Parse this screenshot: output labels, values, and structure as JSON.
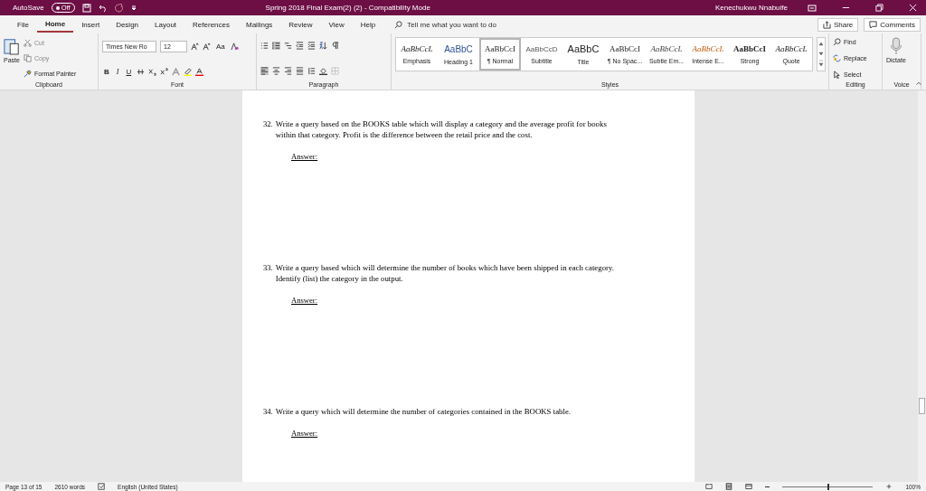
{
  "title_bar": {
    "autosave_label": "AutoSave",
    "autosave_toggle": {
      "label": "Off",
      "on": false
    },
    "title": "Spring 2018 Final Exam(2) (2)  -  Compatibility Mode",
    "user": "Kenechukwu Nnabuife"
  },
  "tabs": [
    {
      "label": "File",
      "selected": false
    },
    {
      "label": "Home",
      "selected": true
    },
    {
      "label": "Insert",
      "selected": false
    },
    {
      "label": "Design",
      "selected": false
    },
    {
      "label": "Layout",
      "selected": false
    },
    {
      "label": "References",
      "selected": false
    },
    {
      "label": "Mailings",
      "selected": false
    },
    {
      "label": "Review",
      "selected": false
    },
    {
      "label": "View",
      "selected": false
    },
    {
      "label": "Help",
      "selected": false
    }
  ],
  "tell_me": {
    "placeholder": "Tell me what you want to do"
  },
  "share": "Share",
  "comments": "Comments",
  "clipboard": {
    "paste": "Paste",
    "cut": "Cut",
    "copy": "Copy",
    "format_painter": "Format Painter",
    "label": "Clipboard"
  },
  "font": {
    "font_name": "Times New Ro",
    "font_size": "12",
    "change_case": "Aa",
    "bold": "B",
    "italic": "I",
    "underline": "U",
    "label": "Font"
  },
  "paragraph": {
    "label": "Paragraph"
  },
  "styles": {
    "label": "Styles",
    "items": [
      {
        "kind": "emphasis",
        "sample": "AaBbCcL",
        "name": "Emphasis",
        "selected": false
      },
      {
        "kind": "heading",
        "sample": "AaBbC",
        "name": "Heading 1",
        "selected": false
      },
      {
        "kind": "normal",
        "sample": "AaBbCcI",
        "name": "¶ Normal",
        "selected": true
      },
      {
        "kind": "subtitle",
        "sample": "AaBbCcD",
        "name": "Subtitle",
        "selected": false
      },
      {
        "kind": "title",
        "sample": "AaBbC",
        "name": "Title",
        "selected": false
      },
      {
        "kind": "normal",
        "sample": "AaBbCcI",
        "name": "¶ No Spac...",
        "selected": false
      },
      {
        "kind": "subtle",
        "sample": "AaBbCcL",
        "name": "Subtle Em...",
        "selected": false
      },
      {
        "kind": "intense",
        "sample": "AaBbCcL",
        "name": "Intense E...",
        "selected": false
      },
      {
        "kind": "strong",
        "sample": "AaBbCcI",
        "name": "Strong",
        "selected": false
      },
      {
        "kind": "emphasis",
        "sample": "AaBbCcL",
        "name": "Quote",
        "selected": false
      }
    ]
  },
  "editing": {
    "find": "Find",
    "replace": "Replace",
    "select": "Select",
    "label": "Editing"
  },
  "voice": {
    "dictate": "Dictate",
    "label": "Voice"
  },
  "questions": [
    {
      "number": "32.",
      "text": "Write a query based on the BOOKS table which will display a category and the average profit for books within that category.  Profit is the difference between the retail price and the cost.",
      "answer": "Answer:"
    },
    {
      "number": "33.",
      "text": "Write a query based which will determine the number of books which have been shipped in each category.  Identify (list) the category in the output.",
      "answer": "Answer:"
    },
    {
      "number": "34.",
      "text": "Write a query which will determine the number of categories contained in the BOOKS table.",
      "answer": "Answer:"
    }
  ],
  "status_bar": {
    "page": "Page 13 of 15",
    "words": "2610 words",
    "language": "English (United States)",
    "zoom": "100%",
    "zoom_slider": {
      "level": 0.5
    }
  }
}
